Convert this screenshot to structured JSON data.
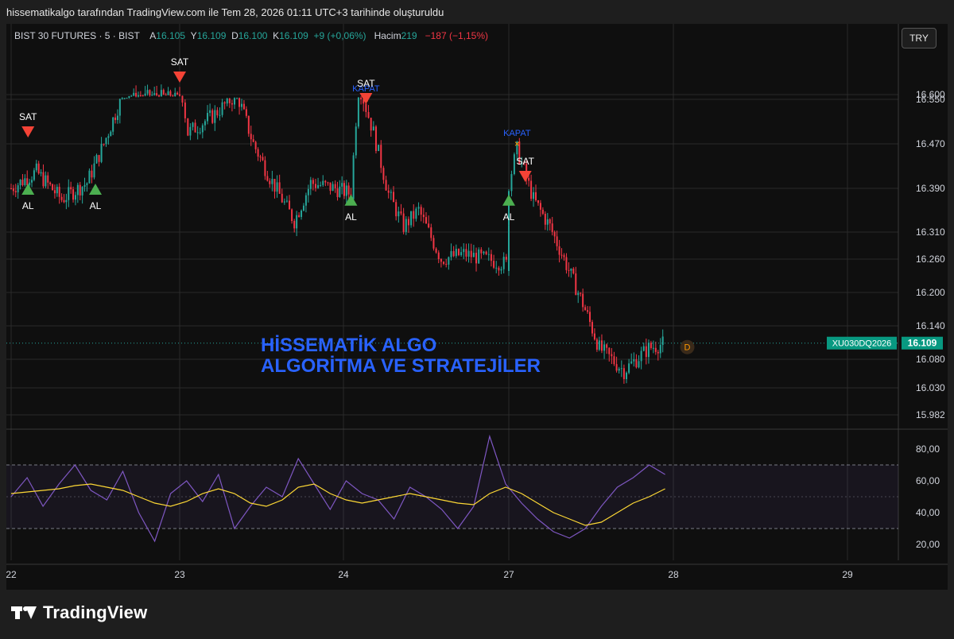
{
  "caption": "hissematikalgo tarafından TradingView.com ile Tem 28, 2026 01:11 UTC+3 tarihinde oluşturuldu",
  "legend": {
    "symbol": "BIST 30 FUTURES · 5 · BIST",
    "open_label": "A",
    "open": "16.105",
    "high_label": "Y",
    "high": "16.109",
    "low_label": "D",
    "low": "16.100",
    "close_label": "K",
    "close": "16.109",
    "change": "+9 (+0,06%)",
    "volume_label": "Hacim",
    "volume": "219",
    "volume_change": "−187 (−1,15%)"
  },
  "currency_button": "TRY",
  "watermark_line1": "HİSSEMATİK ALGO",
  "watermark_line2": "ALGORİTMA VE  STRATEJİLER",
  "last_price_symbol": "XU030DQ2026",
  "last_price": "16.109",
  "dividend_marker": "D",
  "brand": "TradingView",
  "colors": {
    "up": "#26a69a",
    "down": "#f23645",
    "buy_marker": "#4caf50",
    "sell_marker": "#f44336",
    "close_marker_text": "#2962ff",
    "rsi_line": "#7e57c2",
    "rsi_ma": "#fdd835",
    "watermark": "#2962ff"
  },
  "chart_data": [
    {
      "type": "candlestick",
      "title": "BIST 30 FUTURES · 5 · BIST",
      "x_ticks": [
        "22",
        "23",
        "24",
        "27",
        "28",
        "29"
      ],
      "y_ticks": [
        "16.600",
        "16.550",
        "16.470",
        "16.390",
        "16.310",
        "16.260",
        "16.200",
        "16.140",
        "16.080",
        "16.030",
        "15.982"
      ],
      "last_price": 16.109,
      "signals": [
        {
          "label": "SAT",
          "day": 22.1,
          "price": 16.49
        },
        {
          "label": "AL",
          "day": 22.1,
          "price": 16.39
        },
        {
          "label": "AL",
          "day": 22.5,
          "price": 16.39
        },
        {
          "label": "SAT",
          "day": 23.0,
          "price": 16.63
        },
        {
          "label": "AL",
          "day": 24.05,
          "price": 16.37
        },
        {
          "label": "KAPAT",
          "day": 24.15,
          "price": 16.55
        },
        {
          "label": "SAT",
          "day": 24.15,
          "price": 16.55
        },
        {
          "label": "KAPAT",
          "day": 27.05,
          "price": 16.47
        },
        {
          "label": "SAT",
          "day": 27.1,
          "price": 16.41
        },
        {
          "label": "AL",
          "day": 27.0,
          "price": 16.37
        }
      ],
      "path_points": [
        [
          22.0,
          16.39
        ],
        [
          22.15,
          16.42
        ],
        [
          22.3,
          16.37
        ],
        [
          22.45,
          16.4
        ],
        [
          22.55,
          16.47
        ],
        [
          22.7,
          16.59
        ],
        [
          22.85,
          16.595
        ],
        [
          23.0,
          16.59
        ],
        [
          23.05,
          16.49
        ],
        [
          23.2,
          16.52
        ],
        [
          23.35,
          16.56
        ],
        [
          23.45,
          16.47
        ],
        [
          23.55,
          16.41
        ],
        [
          23.7,
          16.33
        ],
        [
          23.8,
          16.4
        ],
        [
          23.95,
          16.39
        ],
        [
          24.05,
          16.38
        ],
        [
          24.1,
          16.58
        ],
        [
          24.2,
          16.49
        ],
        [
          24.3,
          16.38
        ],
        [
          24.4,
          16.32
        ],
        [
          24.5,
          16.35
        ],
        [
          24.65,
          16.26
        ],
        [
          24.8,
          16.27
        ],
        [
          24.95,
          16.26
        ],
        [
          25.1,
          16.25
        ],
        [
          27.0,
          16.4
        ],
        [
          27.05,
          16.46
        ],
        [
          27.15,
          16.37
        ],
        [
          27.25,
          16.32
        ],
        [
          27.35,
          16.25
        ],
        [
          27.45,
          16.18
        ],
        [
          27.55,
          16.1
        ],
        [
          27.7,
          16.06
        ],
        [
          27.85,
          16.1
        ],
        [
          27.95,
          16.109
        ]
      ]
    },
    {
      "type": "line",
      "title": "RSI",
      "y_ticks": [
        "80,00",
        "60,00",
        "40,00",
        "20,00"
      ],
      "upper_band": 70,
      "lower_band": 30,
      "series": [
        {
          "values": [
            50,
            62,
            44,
            58,
            70,
            54,
            48,
            66,
            40,
            22,
            52,
            60,
            47,
            64,
            30,
            44,
            56,
            50,
            74,
            58,
            42,
            60,
            52,
            48,
            36,
            56,
            50,
            42,
            30,
            44,
            88,
            58,
            46,
            36,
            28,
            24,
            30,
            44,
            56,
            62,
            70,
            64
          ]
        },
        {
          "values": [
            52,
            53,
            54,
            55,
            57,
            58,
            56,
            54,
            50,
            46,
            44,
            47,
            52,
            55,
            52,
            46,
            44,
            48,
            56,
            58,
            52,
            48,
            46,
            48,
            50,
            52,
            50,
            48,
            46,
            45,
            52,
            56,
            52,
            46,
            40,
            36,
            32,
            34,
            40,
            46,
            50,
            55
          ]
        }
      ]
    }
  ]
}
